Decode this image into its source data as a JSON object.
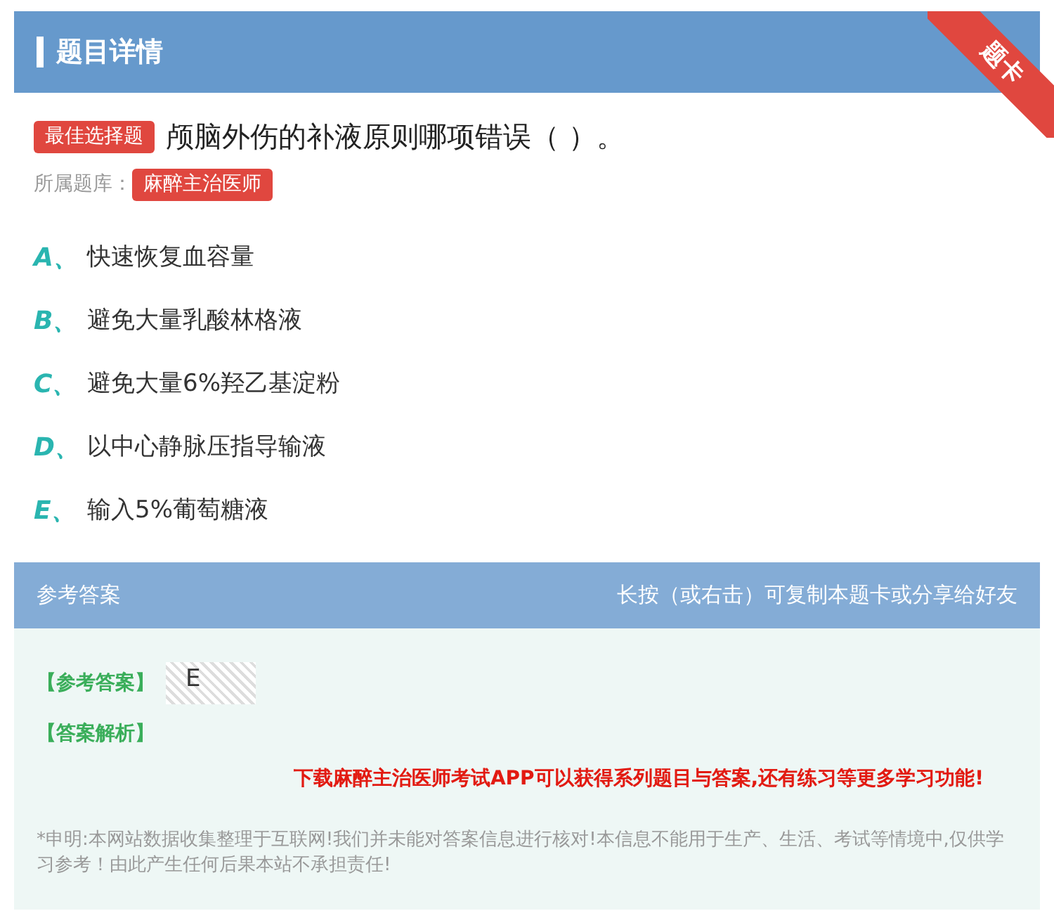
{
  "header": {
    "title": "题目详情",
    "ribbon": "题卡"
  },
  "question": {
    "type_tag": "最佳选择题",
    "text": "颅脑外伤的补液原则哪项错误（  ）。",
    "bank_label": "所属题库：",
    "bank": "麻醉主治医师"
  },
  "options": [
    {
      "letter": "A、",
      "text": "快速恢复血容量"
    },
    {
      "letter": "B、",
      "text": "避免大量乳酸林格液"
    },
    {
      "letter": "C、",
      "text": "避免大量6%羟乙基淀粉"
    },
    {
      "letter": "D、",
      "text": "以中心静脉压指导输液"
    },
    {
      "letter": "E、",
      "text": "输入5%葡萄糖液"
    }
  ],
  "answer_panel": {
    "title": "参考答案",
    "hint": "长按（或右击）可复制本题卡或分享给好友",
    "answer_label": "【参考答案】",
    "answer": "E",
    "analysis_label": "【答案解析】",
    "promo": "下载麻醉主治医师考试APP可以获得系列题目与答案,还有练习等更多学习功能!",
    "disclaimer": "*申明:本网站数据收集整理于互联网!我们并未能对答案信息进行核对!本信息不能用于生产、生活、考试等情境中,仅供学习参考！由此产生任何后果本站不承担责任!"
  }
}
